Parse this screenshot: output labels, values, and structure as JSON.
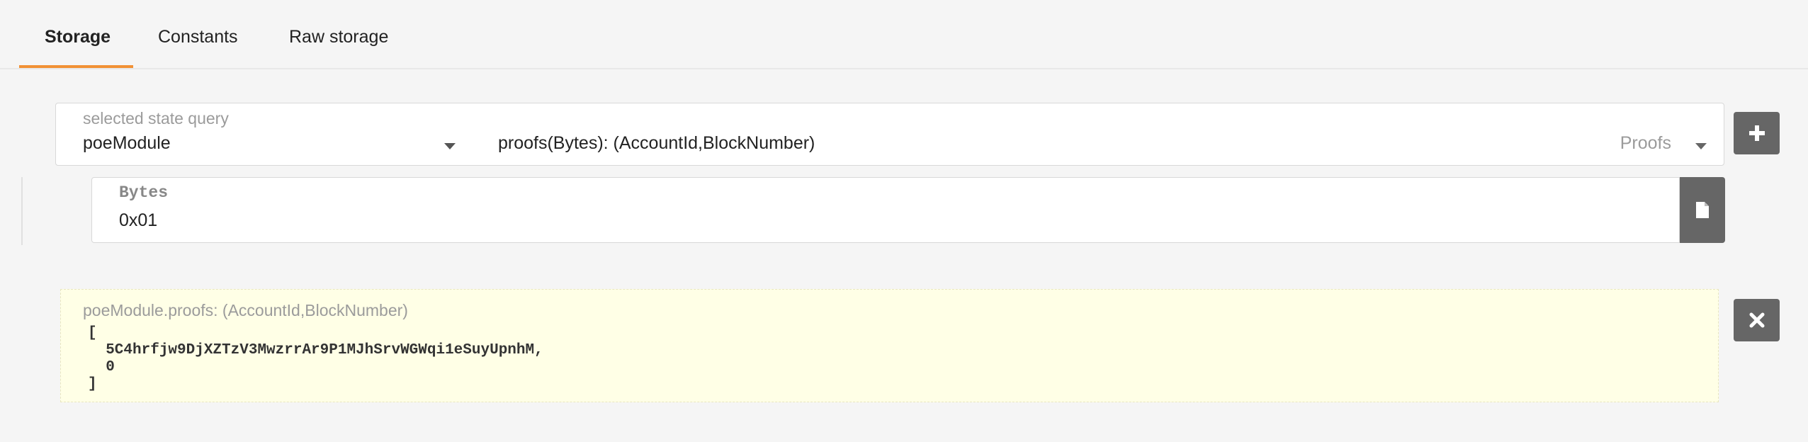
{
  "tabs": [
    {
      "label": "Storage",
      "active": true
    },
    {
      "label": "Constants",
      "active": false
    },
    {
      "label": "Raw storage",
      "active": false
    }
  ],
  "query": {
    "label": "selected state query",
    "module": "poeModule",
    "method": "proofs(Bytes): (AccountId,BlockNumber)",
    "doc": "Proofs"
  },
  "param": {
    "label": "Bytes",
    "value": "0x01"
  },
  "result": {
    "title": "poeModule.proofs: (AccountId,BlockNumber)",
    "body": "[\n  5C4hrfjw9DjXZTzV3MwzrrAr9P1MJhSrvWGWqi1eSuyUpnhM,\n  0\n]"
  },
  "icons": {
    "add": "plus-icon",
    "file": "file-icon",
    "close": "close-icon",
    "dropdown": "chevron-down-icon"
  },
  "colors": {
    "accent": "#f19135",
    "button": "#666666",
    "result_bg": "#ffffe6"
  }
}
